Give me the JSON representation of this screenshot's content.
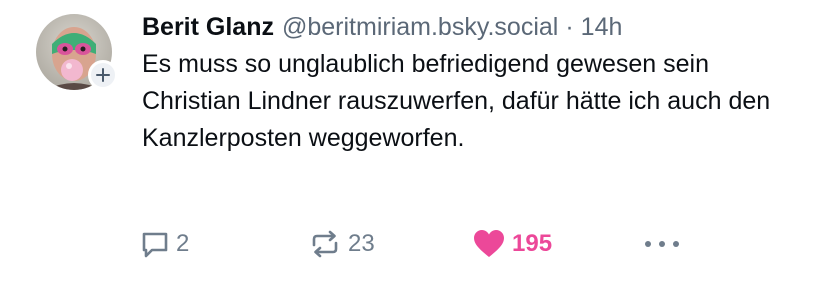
{
  "author": {
    "display_name": "Berit Glanz",
    "handle": "@beritmiriam.bsky.social",
    "separator": "·",
    "time_ago": "14h"
  },
  "post": {
    "text": "Es muss so unglaublich befriedigend gewesen sein Christian Lindner rauszuwerfen, dafür hätte ich auch den Kanzlerposten weggeworfen."
  },
  "actions": {
    "reply_count": "2",
    "repost_count": "23",
    "like_count": "195",
    "reply_icon": "speech-bubble-icon",
    "repost_icon": "repost-arrows-icon",
    "like_icon": "heart-icon",
    "more_icon": "ellipsis-icon"
  },
  "colors": {
    "text": "#0b0f14",
    "muted": "#5b6877",
    "action_gray": "#6f7d8c",
    "like_pink": "#ec4899"
  }
}
